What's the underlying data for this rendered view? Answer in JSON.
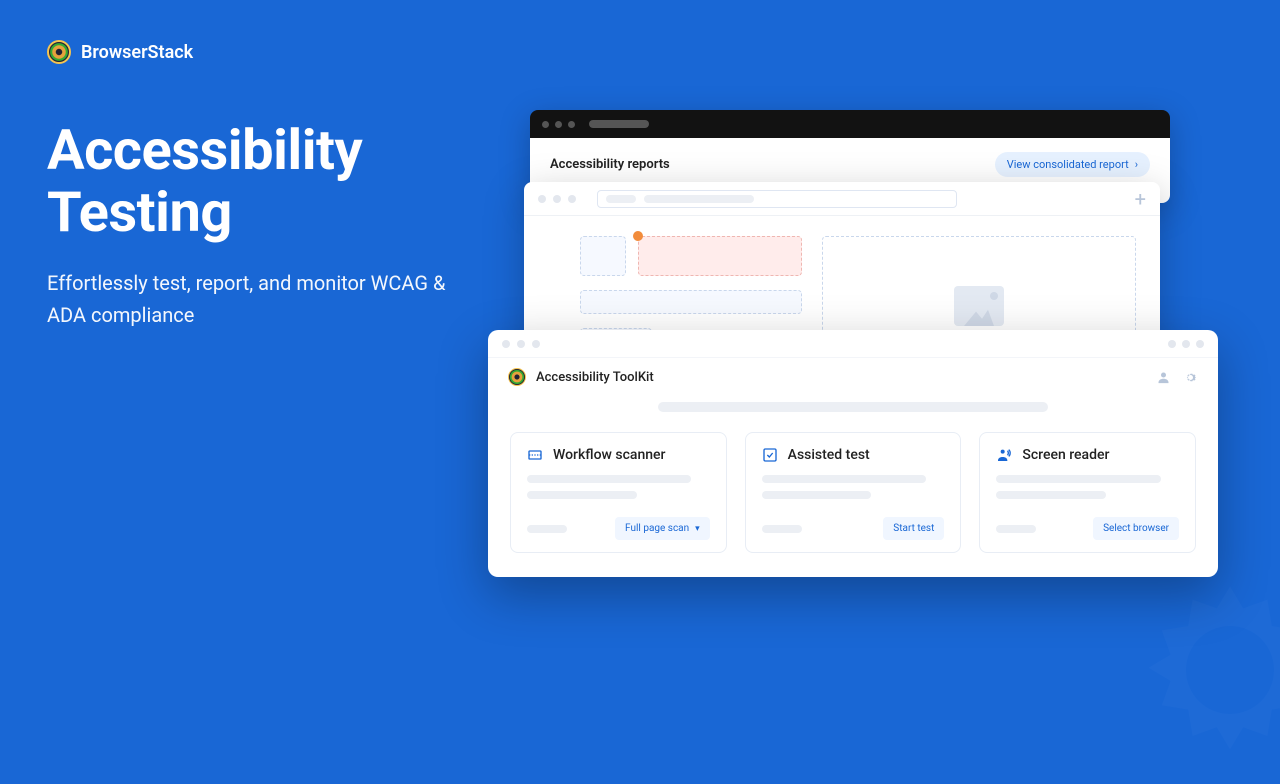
{
  "brand": {
    "name": "BrowserStack"
  },
  "hero": {
    "title": "Accessibility Testing",
    "subtitle": "Effortlessly test, report, and monitor WCAG & ADA compliance"
  },
  "back_window": {
    "section_title": "Accessibility reports",
    "cta": "View consolidated report"
  },
  "toolkit": {
    "title": "Accessibility ToolKit",
    "cards": [
      {
        "title": "Workflow scanner",
        "action": "Full page scan",
        "has_chevron": true
      },
      {
        "title": "Assisted test",
        "action": "Start test",
        "has_chevron": false
      },
      {
        "title": "Screen reader",
        "action": "Select browser",
        "has_chevron": false
      }
    ]
  }
}
